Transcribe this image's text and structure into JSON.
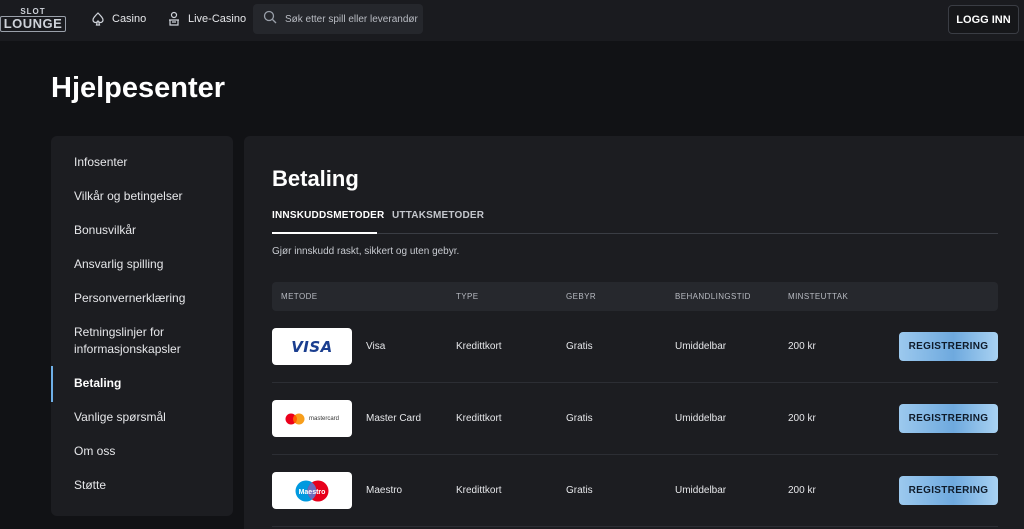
{
  "header": {
    "logo": {
      "top": "SLOT",
      "bottom": "LOUNGE"
    },
    "nav": [
      {
        "label": "Casino",
        "icon": "spade-icon"
      },
      {
        "label": "Live-Casino",
        "icon": "dealer-icon"
      }
    ],
    "search": {
      "placeholder": "Søk etter spill eller leverandør",
      "value": ""
    },
    "login_label": "LOGG INN"
  },
  "page": {
    "title": "Hjelpesenter"
  },
  "sidebar": {
    "items": [
      {
        "label": "Infosenter",
        "active": false
      },
      {
        "label": "Vilkår og betingelser",
        "active": false
      },
      {
        "label": "Bonusvilkår",
        "active": false
      },
      {
        "label": "Ansvarlig spilling",
        "active": false
      },
      {
        "label": "Personvernerklæring",
        "active": false
      },
      {
        "label": "Retningslinjer for informasjonskapsler",
        "active": false
      },
      {
        "label": "Betaling",
        "active": true
      },
      {
        "label": "Vanlige spørsmål",
        "active": false
      },
      {
        "label": "Om oss",
        "active": false
      },
      {
        "label": "Støtte",
        "active": false
      }
    ],
    "accent_color": "#6fb0e8"
  },
  "main": {
    "title": "Betaling",
    "tabs": [
      {
        "label": "INNSKUDDSMETODER",
        "active": true
      },
      {
        "label": "UTTAKSMETODER",
        "active": false
      }
    ],
    "intro": "Gjør innskudd raskt, sikkert og uten gebyr.",
    "table": {
      "columns": [
        "METODE",
        "TYPE",
        "GEBYR",
        "BEHANDLINGSTID",
        "MINSTEUTTAK"
      ],
      "rows": [
        {
          "logo": "VISA",
          "method": "Visa",
          "type": "Kredittkort",
          "fee": "Gratis",
          "time": "Umiddelbar",
          "min": "200 kr",
          "button": "REGISTRERING"
        },
        {
          "logo": "mastercard",
          "method": "Master Card",
          "type": "Kredittkort",
          "fee": "Gratis",
          "time": "Umiddelbar",
          "min": "200 kr",
          "button": "REGISTRERING"
        },
        {
          "logo": "Maestro",
          "method": "Maestro",
          "type": "Kredittkort",
          "fee": "Gratis",
          "time": "Umiddelbar",
          "min": "200 kr",
          "button": "REGISTRERING"
        }
      ]
    }
  }
}
